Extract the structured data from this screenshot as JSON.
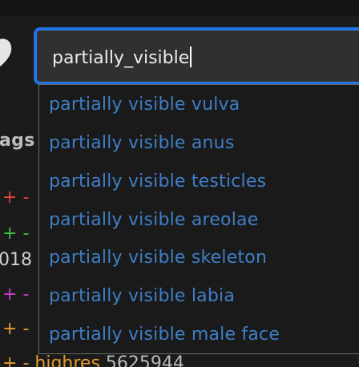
{
  "search": {
    "value": "partially_visible"
  },
  "suggestions": [
    "partially visible vulva",
    "partially visible anus",
    "partially visible testicles",
    "partially visible areolae",
    "partially visible skeleton",
    "partially visible labia",
    "partially visible male face"
  ],
  "sidebar": {
    "heading": "ags",
    "year_fragment": "018",
    "add_symbol": "+",
    "remove_symbol": "-",
    "visible_tag": {
      "name": "highres",
      "count": "5625944"
    }
  },
  "colors": {
    "accent_focus": "#1a73e8",
    "suggestion_text": "#3f7fc6",
    "tag_artist": "#e0453c",
    "tag_copyright": "#3fbf3f",
    "tag_character": "#c23fc8",
    "tag_meta": "#e09a2e"
  },
  "icons": {
    "favorite": "heart-icon"
  }
}
